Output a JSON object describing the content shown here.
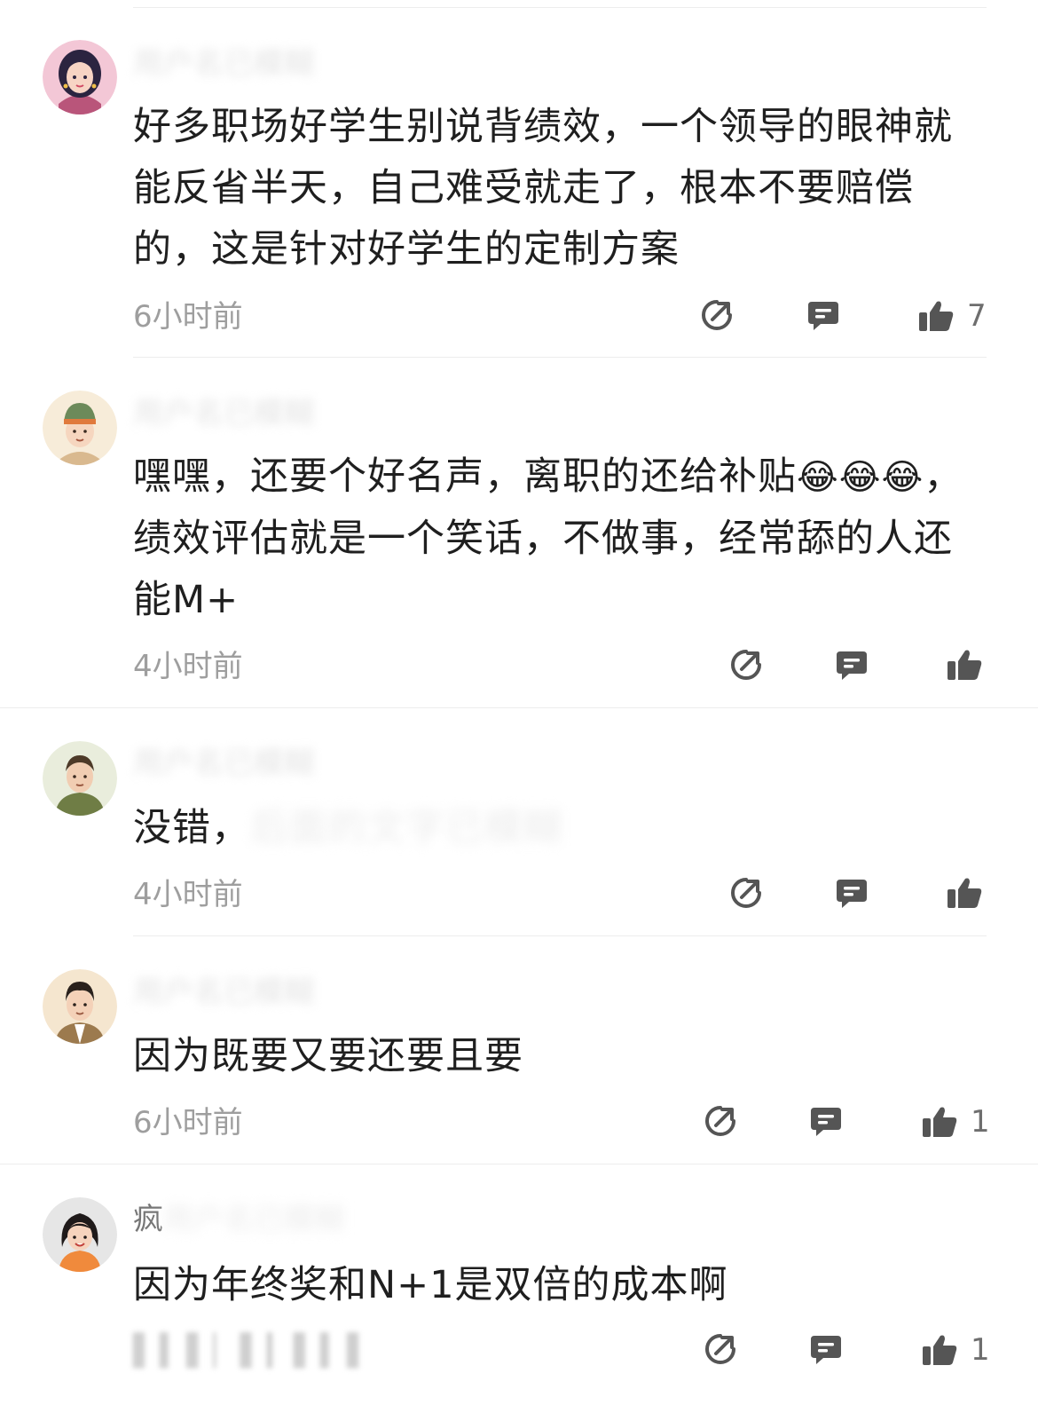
{
  "comments": [
    {
      "username": "用户名已模糊",
      "text": "好多职场好学生别说背绩效，一个领导的眼神就能反省半天，自己难受就走了，根本不要赔偿的，这是针对好学生的定制方案",
      "time": "6小时前",
      "likes": "7"
    },
    {
      "username": "用户名已模糊",
      "text_parts": [
        "嘿嘿，还要个好名声，离职的还给补贴",
        "😂😂😂",
        "，绩效评估就是一个笑话，不做事，经常舔的人还能M+"
      ],
      "time": "4小时前",
      "likes": ""
    },
    {
      "username": "用户名已模糊",
      "text": "没错，",
      "text_blurred": "后面的文字已模糊",
      "time": "4小时前",
      "likes": ""
    },
    {
      "username": "用户名已模糊",
      "text": "因为既要又要还要且要",
      "time": "6小时前",
      "likes": "1"
    },
    {
      "username": "疯",
      "username_blurred": "用户名已模糊",
      "text": "因为年终奖和N+1是双倍的成本啊",
      "time": "",
      "likes": "1"
    }
  ],
  "icons": {
    "share": "share-icon",
    "reply": "reply-icon",
    "like": "thumbs-up-icon"
  },
  "colors": {
    "icon": "#555555",
    "meta": "#9e9e9e",
    "text": "#1f1f1f"
  }
}
